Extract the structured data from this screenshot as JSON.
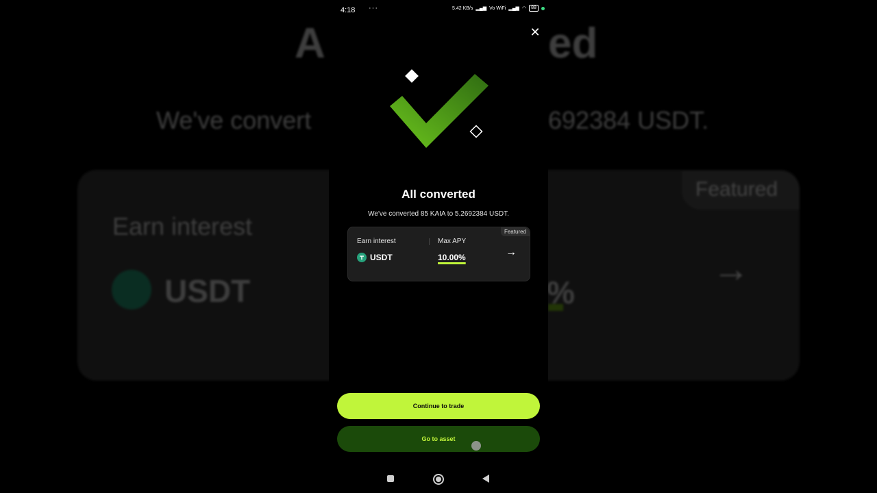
{
  "status_bar": {
    "time": "4:18",
    "extra": "···",
    "net_speed": "5.42 KB/s",
    "wifi_label": "Vo WiFi",
    "battery": "88"
  },
  "modal": {
    "close_icon": "close-icon",
    "title": "All converted",
    "subtitle": "We've converted 85 KAIA to 5.2692384 USDT.",
    "promo_card": {
      "badge": "Featured",
      "left_label": "Earn interest",
      "right_label": "Max APY",
      "asset": "USDT",
      "apy": "10.00%",
      "arrow_icon": "arrow-right-icon"
    }
  },
  "actions": {
    "primary": "Continue to trade",
    "secondary": "Go to asset"
  },
  "background_echo": {
    "title_left": "A",
    "title_right": "ed",
    "sub_left": "We've convert",
    "sub_right": "692384 USDT.",
    "earn": "Earn interest",
    "asset": "USDT",
    "featured": "Featured",
    "pct": "%",
    "arrow": "→"
  },
  "colors": {
    "accent": "#c0f53a",
    "secondary_button": "#1b4a0a",
    "check_green": "#4c9a1a",
    "tether": "#26a17b"
  }
}
